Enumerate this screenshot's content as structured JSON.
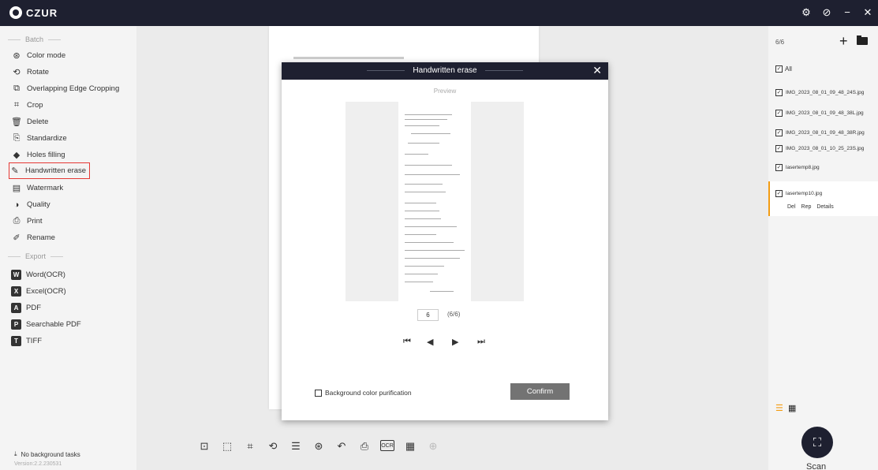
{
  "app": {
    "title": "CZUR"
  },
  "window_controls": {
    "settings": "⚙",
    "help": "⊘",
    "minimize": "−",
    "close": "✕"
  },
  "sidebar": {
    "batch_title": "Batch",
    "batch_items": [
      {
        "label": "Color mode",
        "icon": "color-mode-icon"
      },
      {
        "label": "Rotate",
        "icon": "rotate-icon"
      },
      {
        "label": "Overlapping Edge Cropping",
        "icon": "overlap-crop-icon"
      },
      {
        "label": "Crop",
        "icon": "crop-icon"
      },
      {
        "label": "Delete",
        "icon": "delete-icon"
      },
      {
        "label": "Standardize",
        "icon": "standardize-icon"
      },
      {
        "label": "Holes filling",
        "icon": "holes-filling-icon"
      },
      {
        "label": "Handwritten erase",
        "icon": "handwritten-erase-icon",
        "selected": true
      },
      {
        "label": "Watermark",
        "icon": "watermark-icon"
      },
      {
        "label": "Quality",
        "icon": "quality-icon"
      },
      {
        "label": "Print",
        "icon": "print-icon"
      },
      {
        "label": "Rename",
        "icon": "rename-icon"
      }
    ],
    "export_title": "Export",
    "export_items": [
      {
        "label": "Word(OCR)",
        "glyph": "W"
      },
      {
        "label": "Excel(OCR)",
        "glyph": "X"
      },
      {
        "label": "PDF",
        "glyph": "A"
      },
      {
        "label": "Searchable PDF",
        "glyph": "P"
      },
      {
        "label": "TIFF",
        "glyph": "T"
      }
    ],
    "bg_tasks": "No background tasks",
    "version": "Version:2.2.230531"
  },
  "dialog": {
    "title": "Handwritten erase",
    "close": "✕",
    "preview_label": "Preview",
    "page_value": "6",
    "page_count": "(6/6)",
    "nav": {
      "first": "⏮",
      "prev": "◀",
      "next": "▶",
      "last": "⏭"
    },
    "bg_purification_label": "Background color purification",
    "bg_purification_checked": false,
    "confirm_label": "Confirm"
  },
  "toolbar": [
    {
      "name": "adjust-icon",
      "glyph": "⊡"
    },
    {
      "name": "select-icon",
      "glyph": "⬚"
    },
    {
      "name": "crop-tool-icon",
      "glyph": "⌗"
    },
    {
      "name": "rotate-tool-icon",
      "glyph": "⟲"
    },
    {
      "name": "list-tool-icon",
      "glyph": "☰"
    },
    {
      "name": "color-tool-icon",
      "glyph": "⊛"
    },
    {
      "name": "undo-icon",
      "glyph": "↶"
    },
    {
      "name": "print-tool-icon",
      "glyph": "⎙"
    },
    {
      "name": "ocr-icon",
      "glyph": "OCR"
    },
    {
      "name": "qr-icon",
      "glyph": "▦"
    },
    {
      "name": "split-icon",
      "glyph": "⊕",
      "disabled": true
    }
  ],
  "right_panel": {
    "count": "6/6",
    "add": "+",
    "all_label": "All",
    "files": [
      {
        "name": "IMG_2023_08_01_09_48_24S.jpg",
        "checked": true
      },
      {
        "name": "IMG_2023_08_01_09_48_38L.jpg",
        "checked": true
      },
      {
        "name": "IMG_2023_08_01_09_48_38R.jpg",
        "checked": true
      },
      {
        "name": "IMG_2023_08_01_10_25_23S.jpg",
        "checked": true
      },
      {
        "name": "lasertemp8.jpg",
        "checked": true
      },
      {
        "name": "lasertemp10.jpg",
        "checked": true,
        "selected": true
      }
    ],
    "file_actions": [
      "Del",
      "Rep",
      "Details"
    ],
    "scan_label": "Scan"
  }
}
